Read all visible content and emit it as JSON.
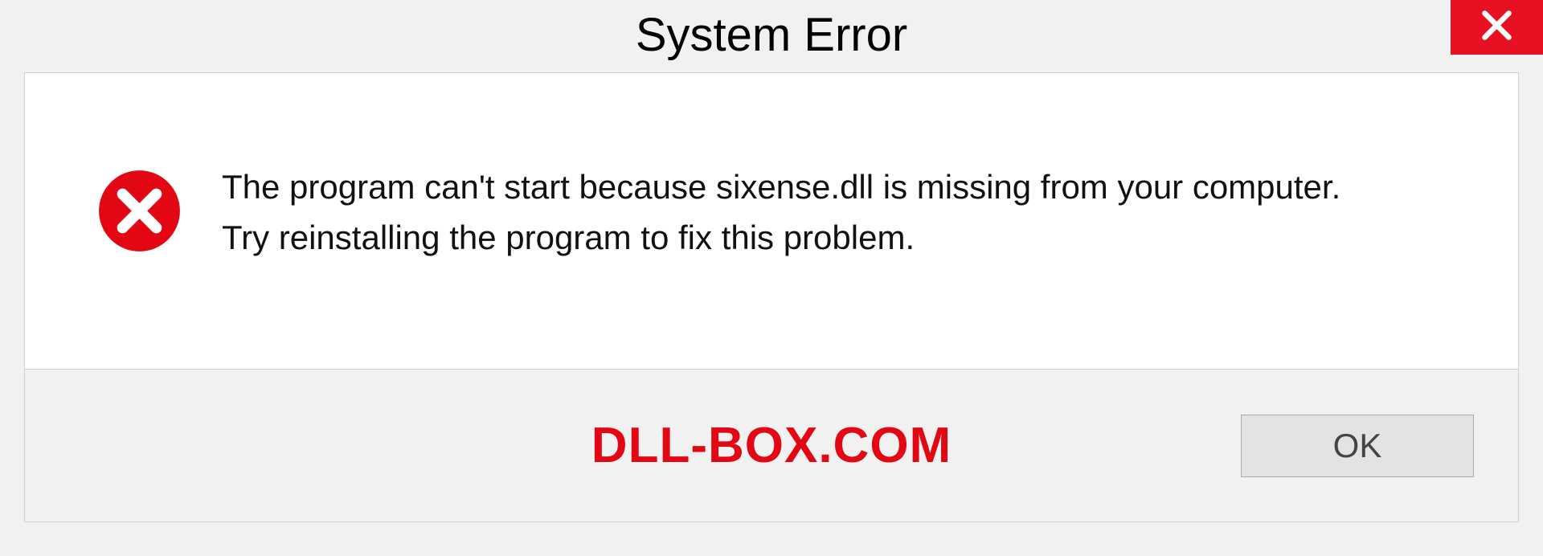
{
  "titlebar": {
    "title": "System Error"
  },
  "message": {
    "line1": "The program can't start because sixense.dll is missing from your computer.",
    "line2": "Try reinstalling the program to fix this problem."
  },
  "footer": {
    "watermark": "DLL-BOX.COM",
    "ok_label": "OK"
  },
  "colors": {
    "close_bg": "#e81123",
    "error_icon": "#e30613",
    "watermark": "#e30613"
  }
}
